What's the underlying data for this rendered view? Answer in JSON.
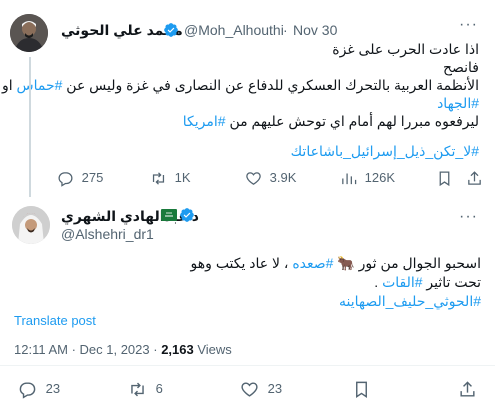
{
  "tweet1": {
    "author_name": "محمد علي الحوثي",
    "handle": "@Moh_Alhouthi",
    "dot": "·",
    "date": "Nov 30",
    "lines": [
      "اذا عادت الحرب على غزة",
      "فانصح",
      "الأنظمة العربية بالتحرك العسكري للدفاع عن النصارى في غزة وليس عن",
      "او",
      "ليرفعوه مبررا لهم أمام اي توحش عليهم من"
    ],
    "hashtags": {
      "hamas": "#حماس",
      "jihad": "#الجهاد",
      "america": "#امريكا",
      "last": "#لا_تكن_ذيل_إسرائيل_باشاعاتك"
    },
    "metrics": {
      "replies": "275",
      "retweets": "1K",
      "likes": "3.9K",
      "views": "126K"
    }
  },
  "tweet2": {
    "author_name": "د عبدالهادي الشهري",
    "flag": "🇸🇦",
    "handle": "@Alshehri_dr1",
    "line1_text": "اسحبو الجوال من ثور",
    "line1_emoji": "🐂",
    "line1_tag": "#صعده",
    "line1_rest": "، لا عاد يكتب وهو",
    "line2_text": "تحت تاثير",
    "line2_tag": "#القات",
    "line2_end": ".",
    "line3_tag": "#الحوثي_حليف_الصهاينه",
    "translate": "Translate post",
    "time": "12:11 AM · Dec 1, 2023 ·",
    "views_count": "2,163",
    "views_label": "Views",
    "metrics": {
      "replies": "23",
      "retweets": "6",
      "likes": "23"
    }
  },
  "icons": {
    "more": "···"
  },
  "colors": {
    "accent": "#1d9bf0",
    "muted": "#536471",
    "text": "#0f1419",
    "thread_line": "#cfd9de",
    "verified": "#1d9bf0"
  }
}
